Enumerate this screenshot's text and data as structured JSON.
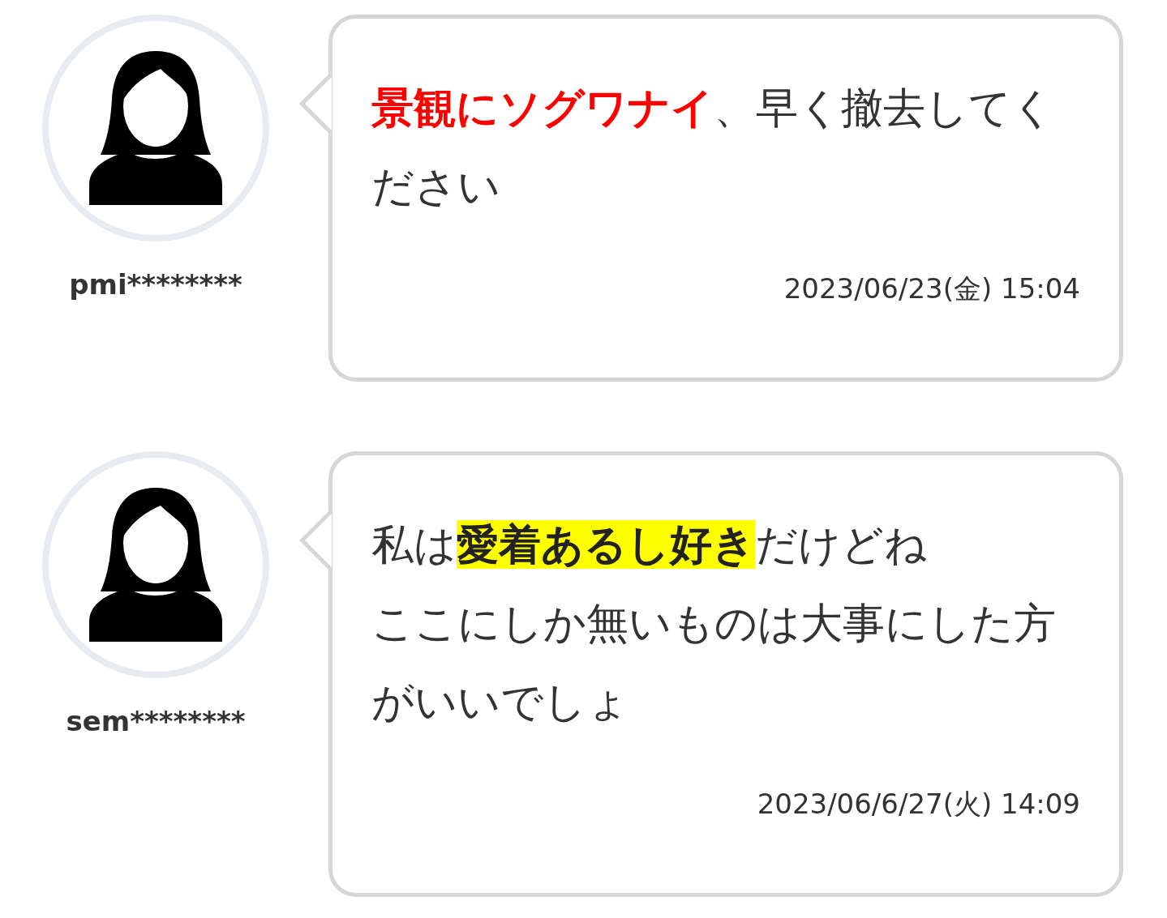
{
  "comments": [
    {
      "user": "pmi********",
      "lines": [
        "**景観にソグワナイ**、早く撤去してください"
      ],
      "kind": "red",
      "date": "2023/06/23(金) 15:04"
    },
    {
      "user": "sem********",
      "lines": [
        "私は**愛着あるし好き**だけどね",
        "ここにしか無いものは大事にした方がいいでしょ"
      ],
      "kind": "highlight",
      "date": "2023/06/6/27(火) 14:09"
    }
  ]
}
